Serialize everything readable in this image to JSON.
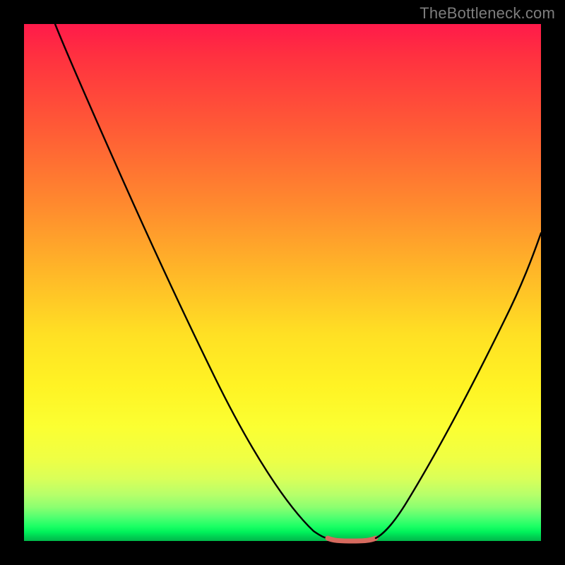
{
  "attribution": "TheBottleneck.com",
  "chart_data": {
    "type": "line",
    "title": "",
    "xlabel": "",
    "ylabel": "",
    "xlim": [
      0,
      100
    ],
    "ylim": [
      0,
      100
    ],
    "grid": false,
    "legend": false,
    "background_gradient": {
      "top_color": "#ff1a4a",
      "mid_color": "#ffe024",
      "bottom_color": "#00b84a"
    },
    "series": [
      {
        "name": "left-curve",
        "color": "#000000",
        "points": [
          {
            "x": 6.0,
            "y": 100.0
          },
          {
            "x": 10.0,
            "y": 90.9
          },
          {
            "x": 16.0,
            "y": 76.7
          },
          {
            "x": 22.0,
            "y": 62.8
          },
          {
            "x": 28.0,
            "y": 49.3
          },
          {
            "x": 34.0,
            "y": 36.3
          },
          {
            "x": 40.0,
            "y": 23.8
          },
          {
            "x": 46.0,
            "y": 12.4
          },
          {
            "x": 52.0,
            "y": 3.8
          },
          {
            "x": 56.0,
            "y": 1.1
          },
          {
            "x": 58.7,
            "y": 0.55
          }
        ]
      },
      {
        "name": "flat-segment",
        "color": "#d66a5e",
        "points": [
          {
            "x": 58.7,
            "y": 0.55
          },
          {
            "x": 60.9,
            "y": 0.0
          },
          {
            "x": 65.8,
            "y": 0.0
          },
          {
            "x": 68.0,
            "y": 0.55
          }
        ]
      },
      {
        "name": "right-curve",
        "color": "#000000",
        "points": [
          {
            "x": 68.0,
            "y": 0.55
          },
          {
            "x": 71.0,
            "y": 2.7
          },
          {
            "x": 76.0,
            "y": 9.6
          },
          {
            "x": 82.0,
            "y": 20.5
          },
          {
            "x": 88.0,
            "y": 32.8
          },
          {
            "x": 94.0,
            "y": 45.9
          },
          {
            "x": 100.0,
            "y": 59.6
          }
        ]
      }
    ]
  }
}
